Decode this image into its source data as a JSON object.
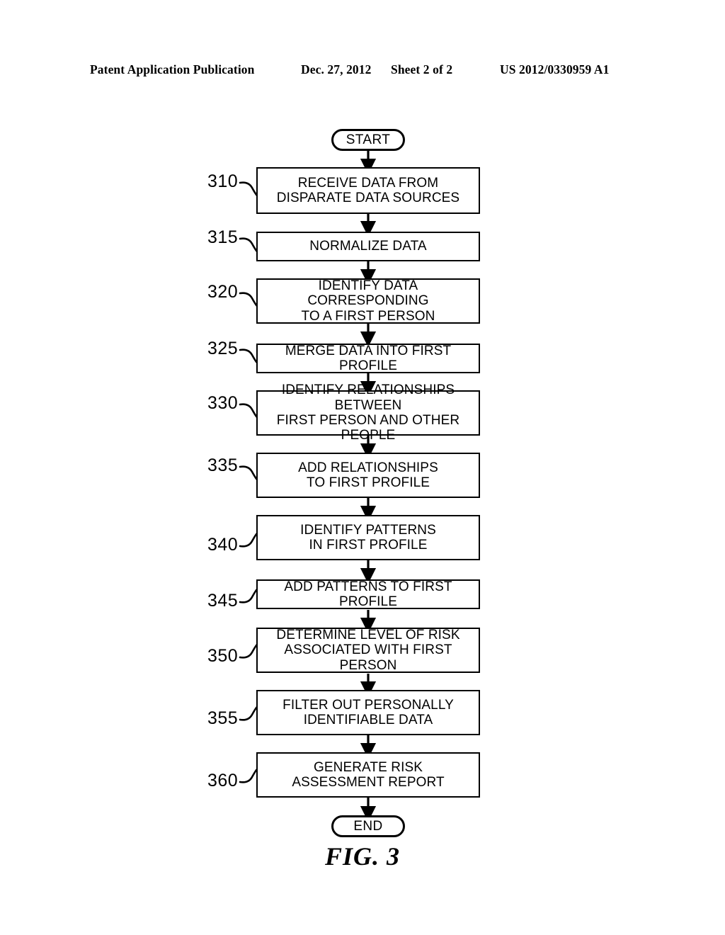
{
  "header": {
    "publication": "Patent Application Publication",
    "date": "Dec. 27, 2012",
    "sheet": "Sheet 2 of 2",
    "number": "US 2012/0330959 A1"
  },
  "figure": {
    "caption": "FIG. 3",
    "start_label": "START",
    "end_label": "END"
  },
  "colors": {
    "ink": "#000000",
    "paper": "#ffffff"
  },
  "flowchart": {
    "type": "flowchart",
    "orientation": "vertical",
    "steps": [
      {
        "ref": "310",
        "text": "RECEIVE DATA FROM\nDISPARATE DATA SOURCES"
      },
      {
        "ref": "315",
        "text": "NORMALIZE DATA"
      },
      {
        "ref": "320",
        "text": "IDENTIFY DATA CORRESPONDING\nTO A FIRST PERSON"
      },
      {
        "ref": "325",
        "text": "MERGE DATA INTO FIRST PROFILE"
      },
      {
        "ref": "330",
        "text": "IDENTIFY RELATIONSHIPS BETWEEN\nFIRST PERSON AND OTHER PEOPLE"
      },
      {
        "ref": "335",
        "text": "ADD RELATIONSHIPS\nTO FIRST PROFILE"
      },
      {
        "ref": "340",
        "text": "IDENTIFY PATTERNS\nIN FIRST PROFILE"
      },
      {
        "ref": "345",
        "text": "ADD PATTERNS TO FIRST PROFILE"
      },
      {
        "ref": "350",
        "text": "DETERMINE LEVEL OF RISK\nASSOCIATED WITH FIRST PERSON"
      },
      {
        "ref": "355",
        "text": "FILTER OUT PERSONALLY\nIDENTIFIABLE DATA"
      },
      {
        "ref": "360",
        "text": "GENERATE RISK\nASSESSMENT REPORT"
      }
    ]
  }
}
